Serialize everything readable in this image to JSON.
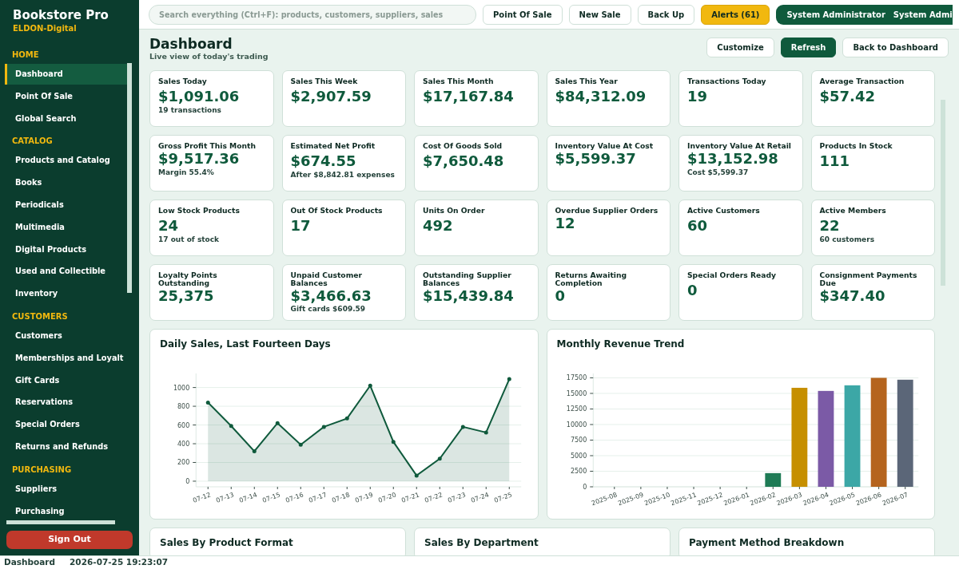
{
  "app": {
    "title": "Bookstore Pro",
    "subtitle": "ELDON-Digital"
  },
  "sidebar": {
    "items": [
      {
        "kind": "header",
        "label": "HOME"
      },
      {
        "kind": "item",
        "label": "Dashboard",
        "selected": true
      },
      {
        "kind": "item",
        "label": "Point Of Sale",
        "selected": false
      },
      {
        "kind": "item",
        "label": "Global Search",
        "selected": false
      },
      {
        "kind": "header",
        "label": "CATALOG"
      },
      {
        "kind": "item",
        "label": "Products and Catalog",
        "selected": false
      },
      {
        "kind": "item",
        "label": "Books",
        "selected": false
      },
      {
        "kind": "item",
        "label": "Periodicals",
        "selected": false
      },
      {
        "kind": "item",
        "label": "Multimedia",
        "selected": false
      },
      {
        "kind": "item",
        "label": "Digital Products",
        "selected": false
      },
      {
        "kind": "item",
        "label": "Used and Collectible",
        "selected": false
      },
      {
        "kind": "item",
        "label": "Inventory",
        "selected": false
      },
      {
        "kind": "header",
        "label": "CUSTOMERS"
      },
      {
        "kind": "item",
        "label": "Customers",
        "selected": false
      },
      {
        "kind": "item",
        "label": "Memberships and Loyalt",
        "selected": false
      },
      {
        "kind": "item",
        "label": "Gift Cards",
        "selected": false
      },
      {
        "kind": "item",
        "label": "Reservations",
        "selected": false
      },
      {
        "kind": "item",
        "label": "Special Orders",
        "selected": false
      },
      {
        "kind": "item",
        "label": "Returns and Refunds",
        "selected": false
      },
      {
        "kind": "header",
        "label": "PURCHASING"
      },
      {
        "kind": "item",
        "label": "Suppliers",
        "selected": false
      },
      {
        "kind": "item",
        "label": "Purchasing",
        "selected": false
      }
    ],
    "sign_out": "Sign Out"
  },
  "toolbar": {
    "search": {
      "placeholder": "Search everything (Ctrl+F): products, customers, suppliers, sales"
    },
    "buttons": [
      {
        "label": "Point Of Sale",
        "kind": "plain"
      },
      {
        "label": "New Sale",
        "kind": "plain"
      },
      {
        "label": "Back Up",
        "kind": "plain"
      },
      {
        "label": "Alerts (61)",
        "kind": "warning"
      }
    ],
    "user": [
      "System Administrator",
      "System Admi"
    ]
  },
  "page": {
    "title": "Dashboard",
    "subtitle": "Live view of today's trading",
    "buttons": [
      {
        "label": "Customize",
        "kind": "plain"
      },
      {
        "label": "Refresh",
        "kind": "primary"
      },
      {
        "label": "Back to Dashboard",
        "kind": "plain"
      }
    ]
  },
  "stats": [
    {
      "label": "Sales Today",
      "value": "$1,091.06",
      "note": "19 transactions"
    },
    {
      "label": "Sales This Week",
      "value": "$2,907.59"
    },
    {
      "label": "Sales This Month",
      "value": "$17,167.84"
    },
    {
      "label": "Sales This Year",
      "value": "$84,312.09"
    },
    {
      "label": "Transactions Today",
      "value": "19"
    },
    {
      "label": "Average Transaction",
      "value": "$57.42"
    },
    {
      "label": "Gross Profit This Month",
      "value": "$9,517.36",
      "note": "Margin 55.4%"
    },
    {
      "label": "Estimated Net Profit",
      "value": "$674.55",
      "note": "After $8,842.81 expenses"
    },
    {
      "label": "Cost Of Goods Sold",
      "value": "$7,650.48"
    },
    {
      "label": "Inventory Value At Cost",
      "value": "$5,599.37"
    },
    {
      "label": "Inventory Value At Retail",
      "value": "$13,152.98",
      "note": "Cost $5,599.37"
    },
    {
      "label": "Products In Stock",
      "value": "111"
    },
    {
      "label": "Low Stock Products",
      "value": "24",
      "note": "17 out of stock"
    },
    {
      "label": "Out Of Stock Products",
      "value": "17"
    },
    {
      "label": "Units On Order",
      "value": "492"
    },
    {
      "label": "Overdue Supplier Orders",
      "value": "12"
    },
    {
      "label": "Active Customers",
      "value": "60"
    },
    {
      "label": "Active Members",
      "value": "22",
      "note": "60 customers"
    },
    {
      "label": "Loyalty Points Outstanding",
      "value": "25,375"
    },
    {
      "label": "Unpaid Customer Balances",
      "value": "$3,466.63",
      "note": "Gift cards $609.59"
    },
    {
      "label": "Outstanding Supplier Balances",
      "value": "$15,439.84"
    },
    {
      "label": "Returns Awaiting Completion",
      "value": "0"
    },
    {
      "label": "Special Orders Ready",
      "value": "0"
    },
    {
      "label": "Consignment Payments Due",
      "value": "$347.40"
    }
  ],
  "charts": [
    {
      "title": "Daily Sales, Last Fourteen Days",
      "chart_data": {
        "type": "area",
        "categories": [
          "07-12",
          "07-13",
          "07-14",
          "07-15",
          "07-16",
          "07-17",
          "07-18",
          "07-19",
          "07-20",
          "07-21",
          "07-22",
          "07-23",
          "07-24",
          "07-25"
        ],
        "series": [
          {
            "color": "#0f5a3c",
            "values": [
              840,
              590,
              320,
              620,
              390,
              580,
              670,
              1020,
              420,
              60,
              240,
              580,
              520,
              1090
            ]
          }
        ],
        "ylim": [
          -60,
          1150
        ],
        "yticks": [
          0,
          200,
          400,
          600,
          800,
          1000
        ],
        "grid": true
      }
    },
    {
      "title": "Monthly Revenue Trend",
      "chart_data": {
        "type": "bar",
        "categories": [
          "2025-08",
          "2025-09",
          "2025-10",
          "2025-11",
          "2025-12",
          "2026-01",
          "2026-02",
          "2026-03",
          "2026-04",
          "2026-05",
          "2026-06",
          "2026-07"
        ],
        "series": [
          {
            "values": [
              0,
              0,
              0,
              0,
              0,
              0,
              2200,
              15900,
              15400,
              16300,
              17500,
              17200
            ]
          }
        ],
        "colors": [
          "#1e7b55",
          "#1e7b55",
          "#1e7b55",
          "#1e7b55",
          "#1e7b55",
          "#1e7b55",
          "#1e7b55",
          "#c68f00",
          "#7b5aa6",
          "#3ca7a6",
          "#b5641e",
          "#5b6678"
        ],
        "ylim": [
          0,
          18200
        ],
        "yticks": [
          0,
          2500,
          5000,
          7500,
          10000,
          12500,
          15000,
          17500
        ],
        "grid": true
      }
    }
  ],
  "lower_panels": [
    "Sales By Product Format",
    "Sales By Department",
    "Payment Method Breakdown"
  ],
  "status_bar": {
    "page": "Dashboard",
    "time": "2026-07-25 19:23:07"
  }
}
